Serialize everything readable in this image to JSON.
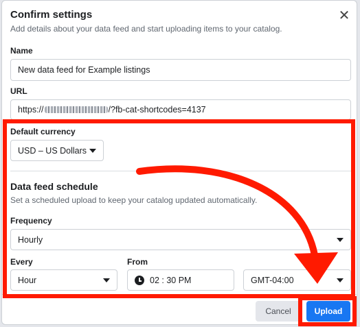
{
  "dialog": {
    "title": "Confirm settings",
    "subtitle": "Add details about your data feed and start uploading items to your catalog.",
    "close_icon": "close-icon"
  },
  "name_field": {
    "label": "Name",
    "value": "New data feed for Example listings"
  },
  "url_field": {
    "label": "URL",
    "prefix": "https://",
    "suffix": "/?fb-cat-shortcodes=4137"
  },
  "currency": {
    "label": "Default currency",
    "value": "USD – US Dollars"
  },
  "schedule": {
    "title": "Data feed schedule",
    "subtitle": "Set a scheduled upload to keep your catalog updated automatically.",
    "frequency_label": "Frequency",
    "frequency_value": "Hourly",
    "every_label": "Every",
    "every_value": "Hour",
    "from_label": "From",
    "from_time": "02 : 30 PM",
    "timezone": "GMT-04:00"
  },
  "footer": {
    "cancel_label": "Cancel",
    "upload_label": "Upload"
  },
  "colors": {
    "highlight": "#ff1a00",
    "primary": "#1877f2"
  },
  "icons": [
    "close-icon",
    "chevron-down-icon",
    "clock-icon",
    "arrow-annotation"
  ]
}
